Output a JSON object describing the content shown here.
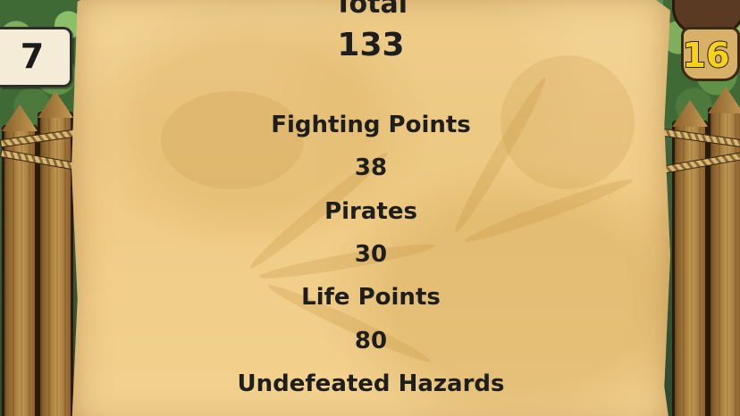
{
  "summary": {
    "heading": "Total",
    "total": "133",
    "rows": [
      {
        "label": "Fighting Points",
        "value": "38"
      },
      {
        "label": "Pirates",
        "value": "30"
      },
      {
        "label": "Life Points",
        "value": "80"
      },
      {
        "label": "Undefeated Hazards"
      }
    ]
  },
  "counters": {
    "left": "7",
    "right": "16"
  },
  "colors": {
    "parchment": "#f0cc86",
    "text": "#1e1e1e",
    "right_counter": "#f6d31a"
  },
  "icons": {
    "left_counter": "leaf-card-icon",
    "right_counter": "pirate-hat-icon"
  }
}
